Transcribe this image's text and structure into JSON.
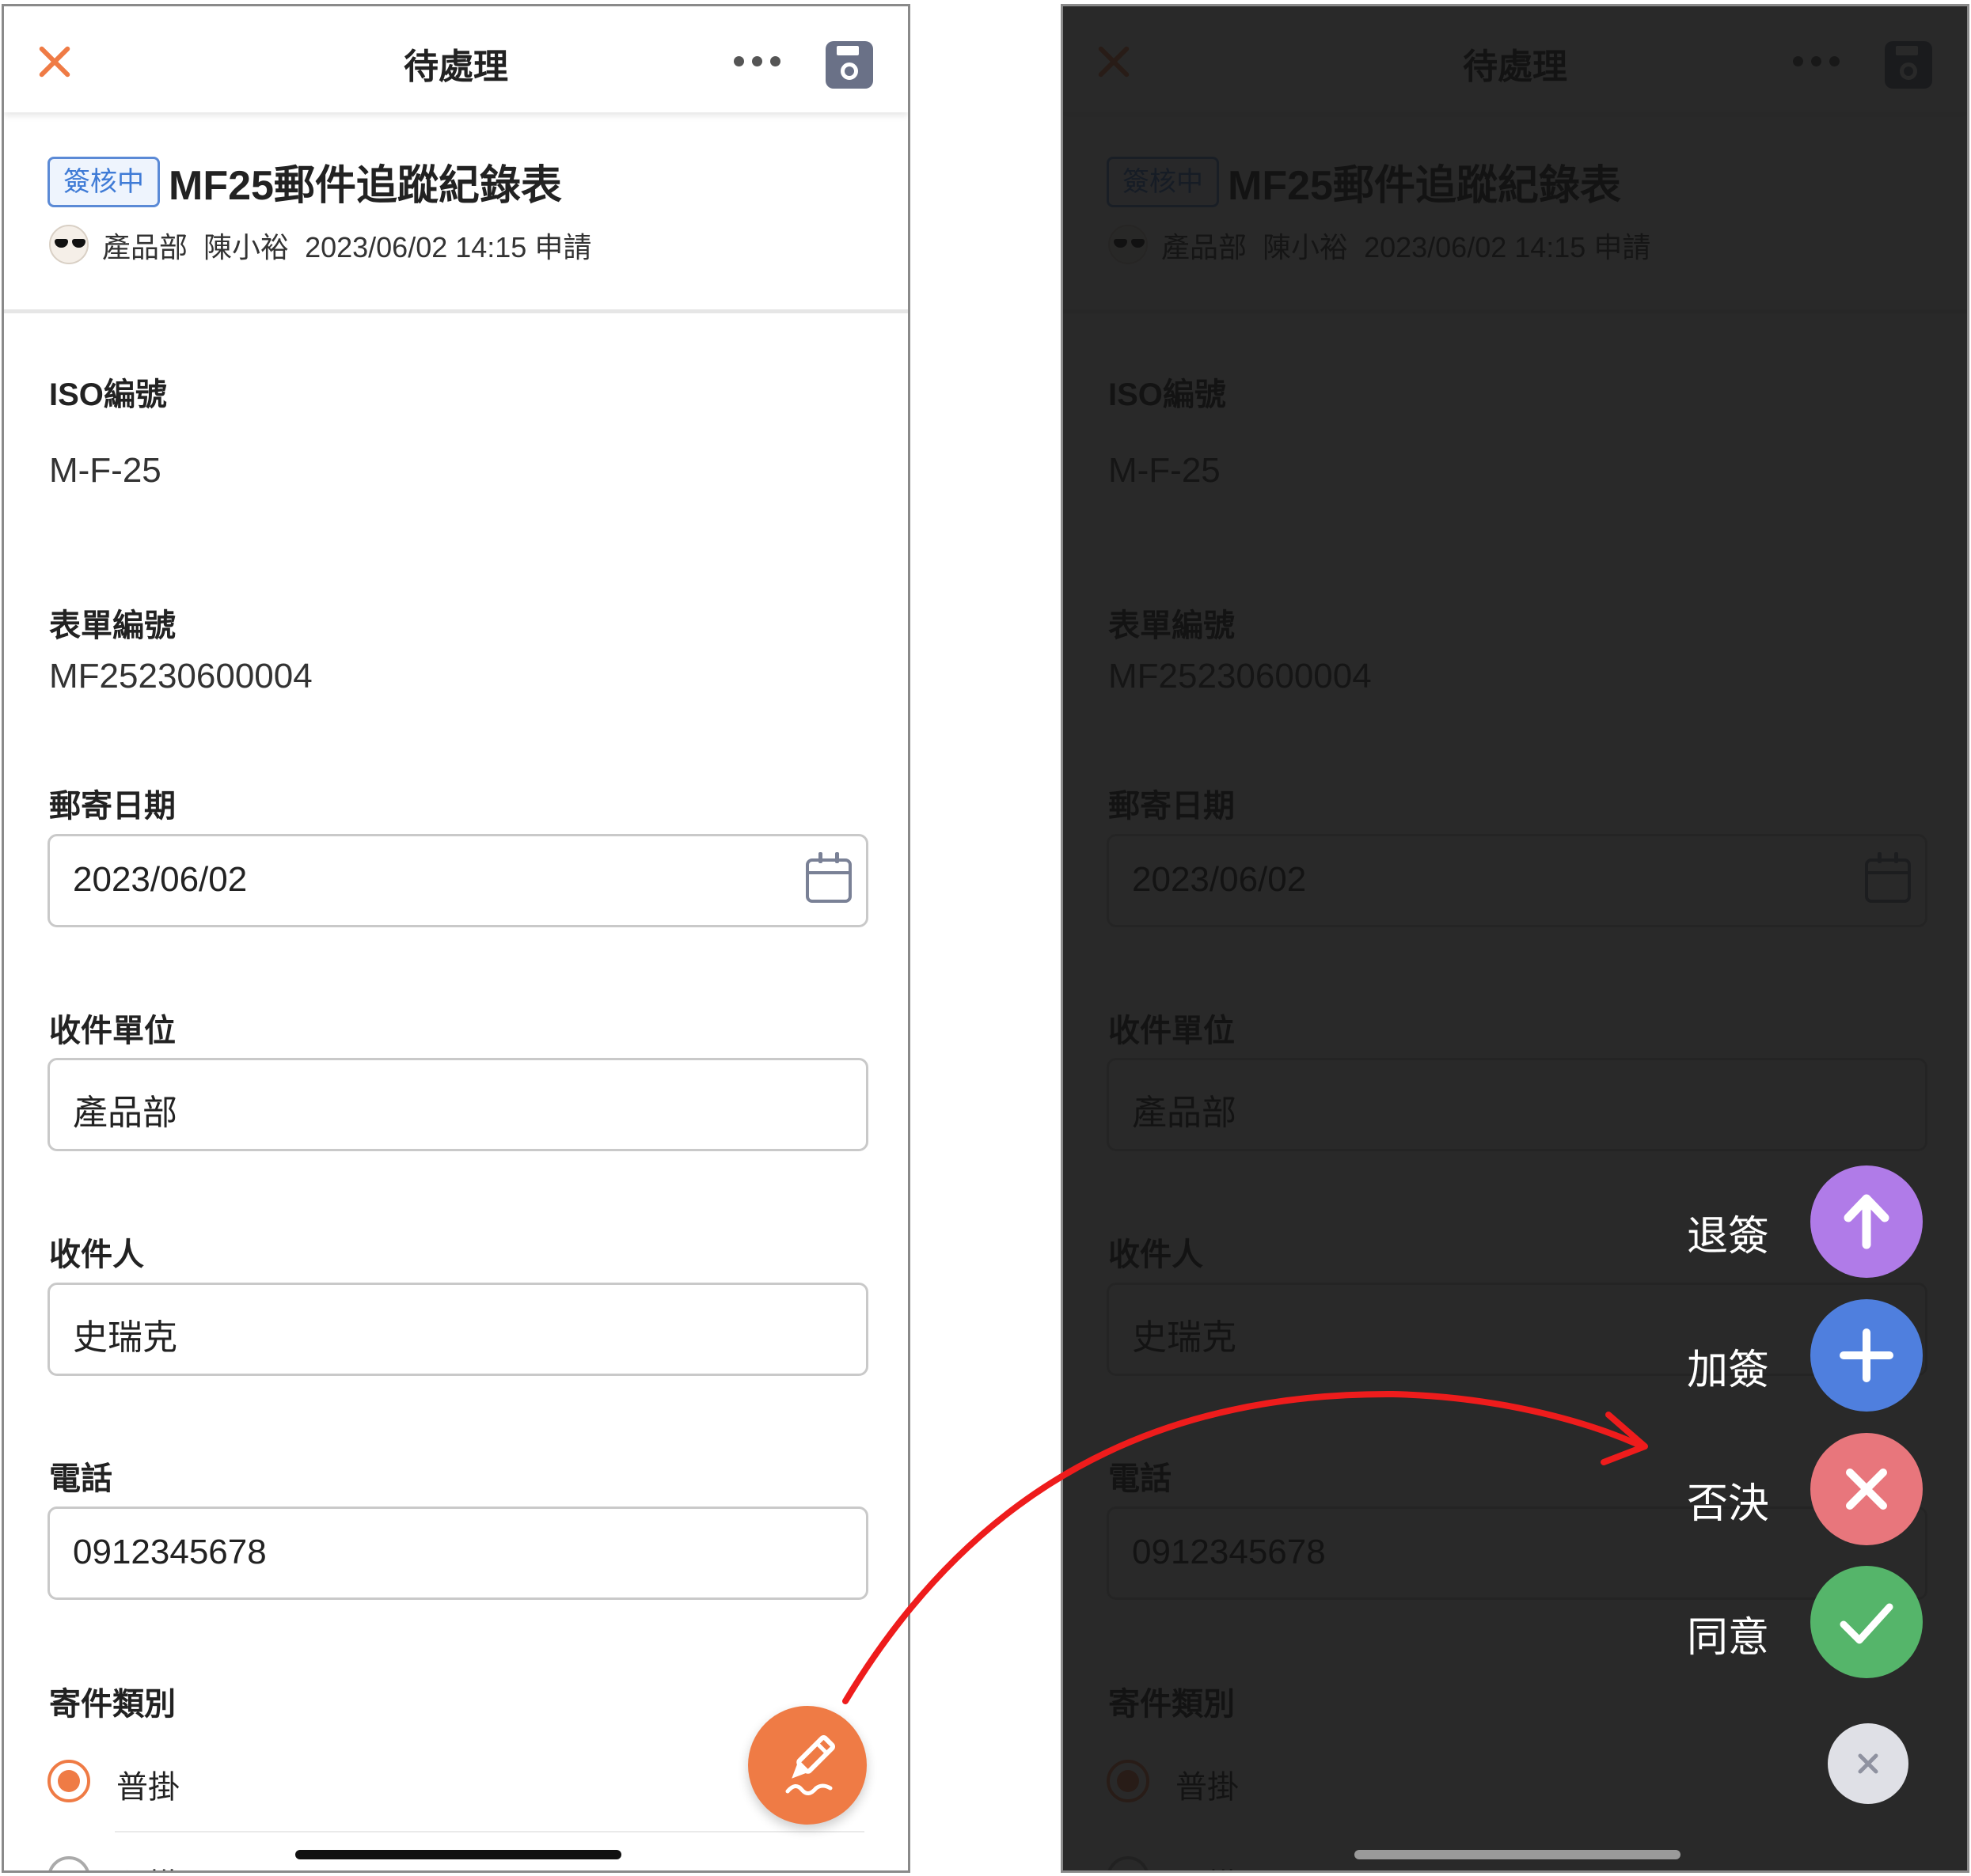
{
  "header": {
    "title": "待處理"
  },
  "form": {
    "status": "簽核中",
    "title": "MF25郵件追蹤紀錄表",
    "department": "產品部",
    "applicant": "陳小裕",
    "datetime": "2023/06/02 14:15",
    "action": "申請"
  },
  "fields": {
    "iso": {
      "label": "ISO編號",
      "value": "M-F-25"
    },
    "form_no": {
      "label": "表單編號",
      "value": "MF25230600004"
    },
    "mail_date": {
      "label": "郵寄日期",
      "value": "2023/06/02"
    },
    "recipient_unit": {
      "label": "收件單位",
      "value": "產品部"
    },
    "recipient": {
      "label": "收件人",
      "value": "史瑞克"
    },
    "phone": {
      "label": "電話",
      "value": "0912345678"
    },
    "mail_type": {
      "label": "寄件類別",
      "options": [
        "普掛",
        "限掛"
      ],
      "selected": "普掛"
    }
  },
  "actions": {
    "return": {
      "label": "退簽",
      "color": "#b07be8"
    },
    "add": {
      "label": "加簽",
      "color": "#4f7fde"
    },
    "reject": {
      "label": "否決",
      "color": "#e8767c"
    },
    "approve": {
      "label": "同意",
      "color": "#55b56a"
    }
  },
  "colors": {
    "accent": "#ef7b45",
    "badge": "#3f7bd6",
    "arrow": "#ee1c1c"
  },
  "icons": [
    "close-icon",
    "more-icon",
    "save-icon",
    "calendar-icon",
    "signature-pen-icon",
    "arrow-up-icon",
    "plus-icon",
    "x-icon",
    "check-icon"
  ]
}
